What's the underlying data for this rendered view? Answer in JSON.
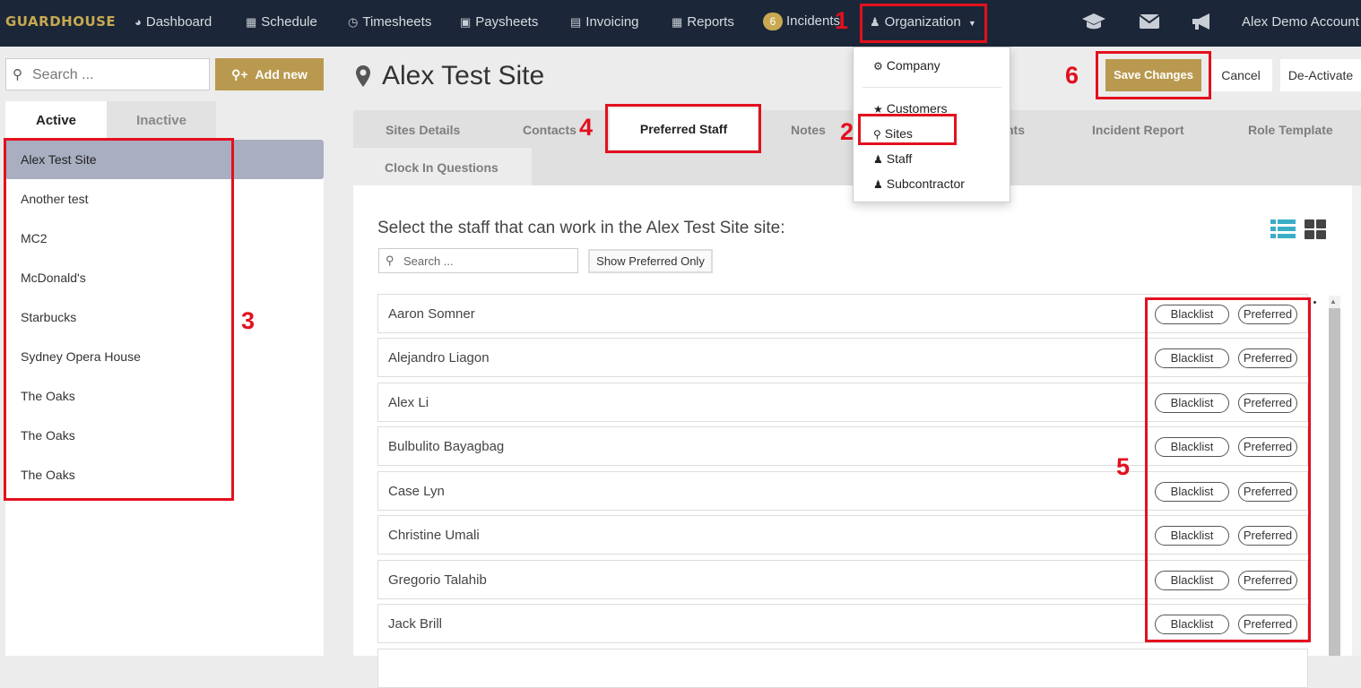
{
  "navbar": {
    "logo": "GUARDHOUSE",
    "items": [
      {
        "label": "Dashboard",
        "icon": "dashboard-icon"
      },
      {
        "label": "Schedule",
        "icon": "calendar-icon"
      },
      {
        "label": "Timesheets",
        "icon": "clock-icon"
      },
      {
        "label": "Paysheets",
        "icon": "money-icon"
      },
      {
        "label": "Invoicing",
        "icon": "invoice-icon"
      },
      {
        "label": "Reports",
        "icon": "table-icon"
      },
      {
        "label": "Incidents",
        "badge": "6"
      },
      {
        "label": "Organization",
        "icon": "users-icon"
      }
    ],
    "account": "Alex Demo Account"
  },
  "org_menu": {
    "items": [
      "Company",
      "Customers",
      "Sites",
      "Staff",
      "Subcontractor"
    ]
  },
  "sidebar": {
    "search_placeholder": "Search ...",
    "add_new": "Add new",
    "tabs": [
      "Active",
      "Inactive"
    ],
    "sites": [
      "Alex Test Site",
      "Another test",
      "MC2",
      "McDonald's",
      "Starbucks",
      "Sydney Opera House",
      "The Oaks",
      "The Oaks",
      "The Oaks"
    ]
  },
  "main": {
    "title": "Alex Test Site",
    "buttons": {
      "save": "Save Changes",
      "cancel": "Cancel",
      "deactivate": "De-Activate"
    },
    "tabs": [
      "Sites Details",
      "Contacts",
      "Preferred Staff",
      "Notes",
      "nts",
      "Incident Report",
      "Role Template",
      "Clock In Questions"
    ],
    "select_label": "Select the staff that can work in the Alex Test Site site:",
    "staff_search_placeholder": "Search ...",
    "show_preferred": "Show Preferred Only",
    "staff": [
      "Aaron Somner",
      "Alejandro Liagon",
      "Alex Li",
      "Bulbulito Bayagbag",
      "Case Lyn",
      "Christine Umali",
      "Gregorio Talahib",
      "Jack Brill"
    ],
    "blacklist_label": "Blacklist",
    "preferred_label": "Preferred"
  },
  "annotations": [
    "1",
    "2",
    "3",
    "4",
    "5",
    "6"
  ],
  "colors": {
    "navbar_bg": "#1b2738",
    "accent_gold": "#b9994f",
    "annotation_red": "#e3101e",
    "active_site_bg": "#a9aec0",
    "view_icon_teal": "#3aaec6"
  }
}
